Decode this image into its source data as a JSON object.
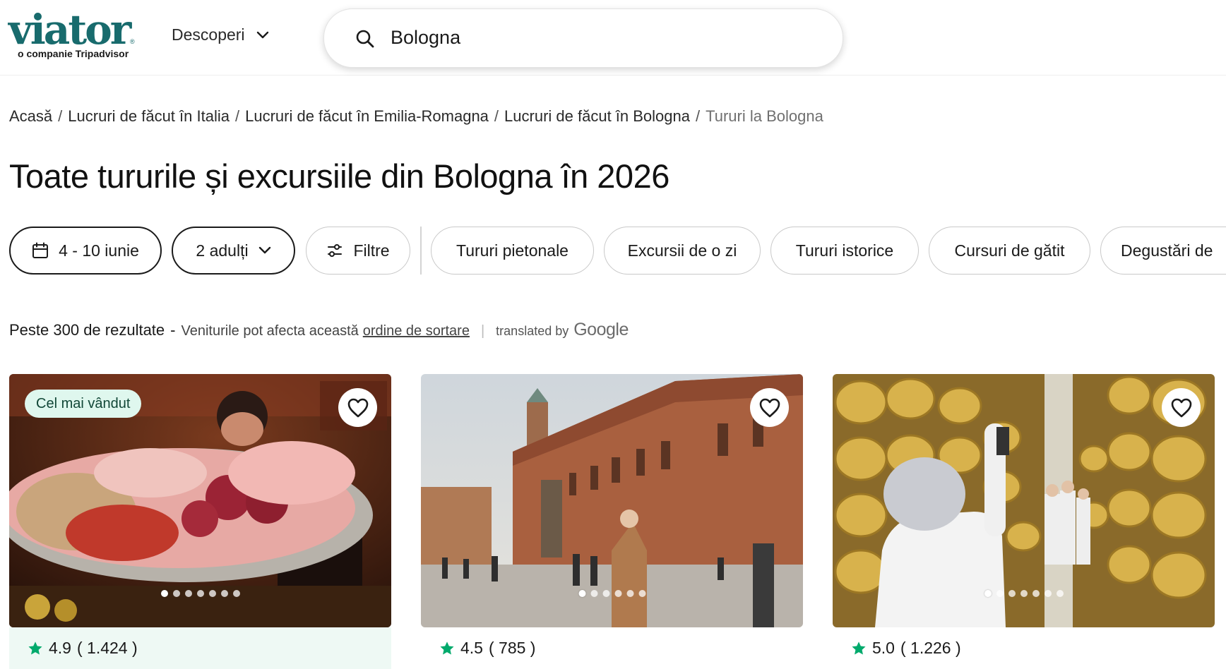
{
  "brand": {
    "name": "viator",
    "registered": "®",
    "tagline": "o companie Tripadvisor",
    "color": "#186b6d"
  },
  "header": {
    "discover_label": "Descoperi",
    "search_value": "Bologna"
  },
  "breadcrumb": {
    "items": [
      "Acasă",
      "Lucruri de făcut în Italia",
      "Lucruri de făcut în Emilia-Romagna",
      "Lucruri de făcut în Bologna"
    ],
    "separator": "/",
    "current": "Tururi la Bologna"
  },
  "page": {
    "title": "Toate tururile și excursiile din Bologna în 2026"
  },
  "filters": {
    "date": "4 - 10 iunie",
    "travelers": "2 adulți",
    "filters_label": "Filtre",
    "categories": [
      "Tururi pietonale",
      "Excursii de o zi",
      "Tururi istorice",
      "Cursuri de gătit",
      "Degustări de"
    ]
  },
  "results": {
    "count": "Peste 300 de rezultate",
    "dash": "-",
    "note": "Veniturile pot afecta această",
    "sort_link": "ordine de sortare",
    "divider": "|",
    "translated_by": "translated by",
    "google": "Google"
  },
  "products": [
    {
      "badge": "Cel mai vândut",
      "rating": "4.9",
      "reviews": "( 1.424 )",
      "image": "Charcuterie platter held by a woman in a deli",
      "dots": 7,
      "active_dot": 0
    },
    {
      "badge": "",
      "rating": "4.5",
      "reviews": "( 785 )",
      "image": "Piazza Maggiore with Palazzo d'Accursio",
      "dots": 6,
      "active_dot": 0
    },
    {
      "badge": "",
      "rating": "5.0",
      "reviews": "( 1.226 )",
      "image": "Parmigiano wheels aging warehouse",
      "dots": 7,
      "active_dot": 0
    }
  ],
  "colors": {
    "star": "#00aa6c",
    "badge_bg": "#dff7ee",
    "tinted_rating": "#eef9f4"
  }
}
